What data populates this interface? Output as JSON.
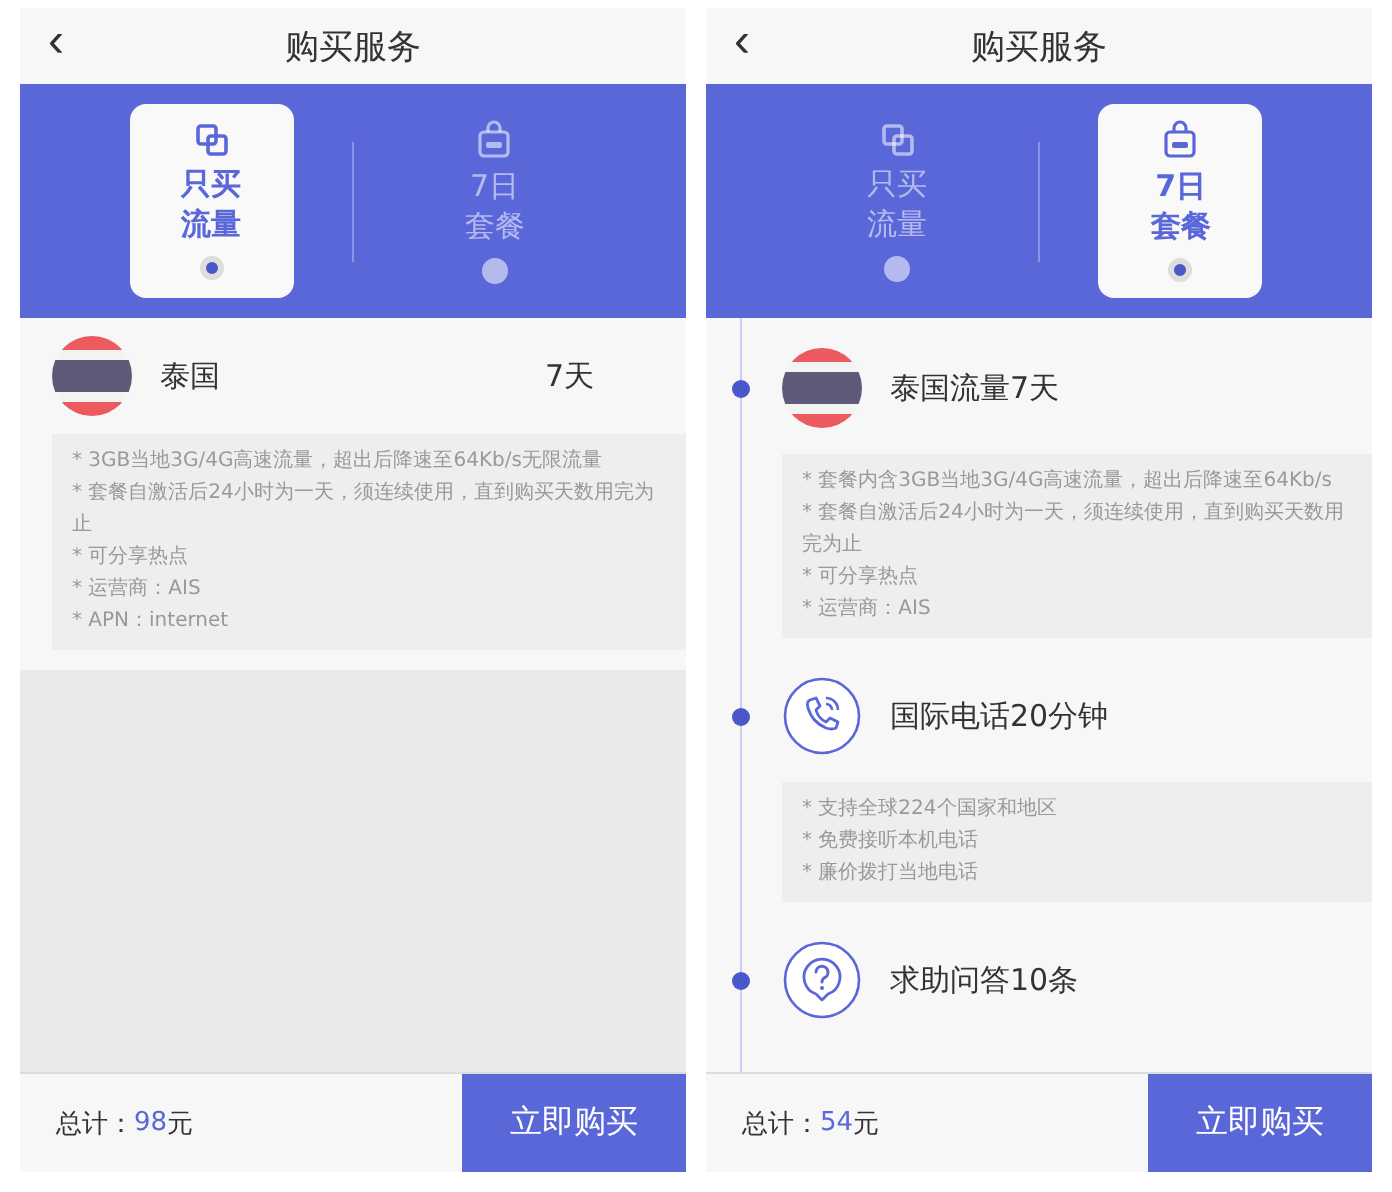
{
  "screens": [
    {
      "kind": "single",
      "title": "购买服务",
      "back": "‹",
      "tabs": [
        {
          "kind": "copy",
          "lines": [
            "只买",
            "流量"
          ],
          "selected": true
        },
        {
          "kind": "bag",
          "lines": [
            "7日",
            "套餐"
          ],
          "selected": false
        }
      ],
      "plan": {
        "kind": "flag",
        "name": "泰国",
        "days": "7天",
        "notes": [
          "* 3GB当地3G/4G高速流量，超出后降速至64Kb/s无限流量",
          "* 套餐自激活后24小时为一天，须连续使用，直到购买天数用完为止",
          "* 可分享热点",
          "* 运营商：AIS",
          "* APN：internet"
        ]
      },
      "footer": {
        "label": "总计：",
        "amount": "98",
        "unit": "元",
        "button": "立即购买"
      }
    },
    {
      "kind": "timeline",
      "title": "购买服务",
      "back": "‹",
      "tabs": [
        {
          "kind": "copy",
          "lines": [
            "只买",
            "流量"
          ],
          "selected": false
        },
        {
          "kind": "bag",
          "lines": [
            "7日",
            "套餐"
          ],
          "selected": true
        }
      ],
      "items": [
        {
          "kind": "flag",
          "title": "泰国流量7天",
          "notes": [
            "* 套餐内含3GB当地3G/4G高速流量，超出后降速至64Kb/s",
            "* 套餐自激活后24小时为一天，须连续使用，直到购买天数用完为止",
            "* 可分享热点",
            "* 运营商：AIS"
          ]
        },
        {
          "kind": "phone",
          "title": "国际电话20分钟",
          "notes": [
            "* 支持全球224个国家和地区",
            "* 免费接听本机电话",
            "* 廉价拨打当地电话"
          ]
        },
        {
          "kind": "question",
          "title": "求助问答10条"
        }
      ],
      "footer": {
        "label": "总计：",
        "amount": "54",
        "unit": "元",
        "button": "立即购买"
      }
    }
  ]
}
